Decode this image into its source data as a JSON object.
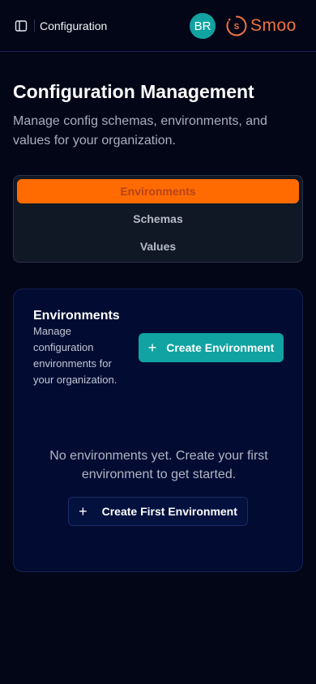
{
  "topbar": {
    "breadcrumb": "Configuration",
    "avatar_initials": "BR",
    "brand_name": "Smoo",
    "brand_logo_letter": "S",
    "icons": {
      "sidebar_toggle": "sidebar-panel-icon",
      "brand": "smoo-logo-icon"
    }
  },
  "header": {
    "title": "Configuration Management",
    "subtitle": "Manage config schemas, environments, and values for your organization."
  },
  "tabs": [
    {
      "label": "Environments",
      "active": true
    },
    {
      "label": "Schemas",
      "active": false
    },
    {
      "label": "Values",
      "active": false
    }
  ],
  "environments_card": {
    "title": "Environments",
    "description": "Manage configuration environments for your organization.",
    "create_button": "Create Environment",
    "empty_message": "No environments yet. Create your first environment to get started.",
    "first_button": "Create First Environment"
  },
  "colors": {
    "background": "#030617",
    "accent_teal": "#11a3a1",
    "active_tab": "#ff6b00",
    "brand_orange": "#f0743e",
    "card_bg": "#020c33"
  }
}
